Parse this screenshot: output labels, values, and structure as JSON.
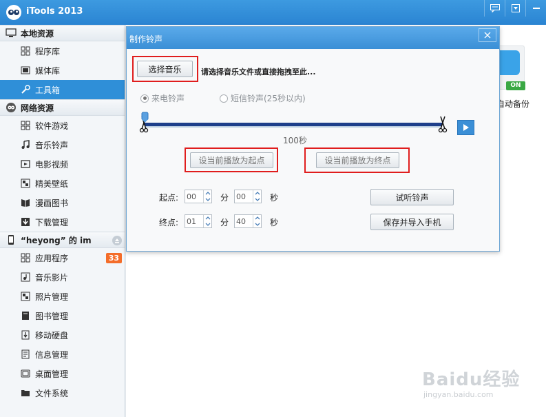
{
  "app": {
    "title": "iTools 2013"
  },
  "window_buttons": [
    {
      "icon": "chat-icon"
    },
    {
      "icon": "dropdown-menu-icon"
    },
    {
      "icon": "minimize-icon"
    }
  ],
  "sidebar": {
    "sections": [
      {
        "title": "本地资源",
        "icon": "computer-icon",
        "items": [
          {
            "label": "程序库",
            "icon": "grid-icon"
          },
          {
            "label": "媒体库",
            "icon": "media-icon"
          },
          {
            "label": "工具箱",
            "icon": "wrench-icon",
            "active": true
          }
        ]
      },
      {
        "title": "网络资源",
        "icon": "globe-icon",
        "items": [
          {
            "label": "软件游戏",
            "icon": "grid-icon"
          },
          {
            "label": "音乐铃声",
            "icon": "music-note-icon"
          },
          {
            "label": "电影视频",
            "icon": "film-icon"
          },
          {
            "label": "精美壁纸",
            "icon": "picture-icon"
          },
          {
            "label": "漫画图书",
            "icon": "book-icon"
          },
          {
            "label": "下载管理",
            "icon": "download-icon"
          }
        ]
      },
      {
        "title": "“heyong” 的 im",
        "icon": "phone-icon",
        "items": [
          {
            "label": "应用程序",
            "icon": "grid-icon",
            "badge": "33"
          },
          {
            "label": "音乐影片",
            "icon": "music-note-icon"
          },
          {
            "label": "照片管理",
            "icon": "picture-icon"
          },
          {
            "label": "图书管理",
            "icon": "book-icon"
          },
          {
            "label": "移动硬盘",
            "icon": "usb-icon"
          },
          {
            "label": "信息管理",
            "icon": "message-icon"
          },
          {
            "label": "桌面管理",
            "icon": "desktop-icon"
          },
          {
            "label": "文件系统",
            "icon": "folder-icon"
          }
        ]
      }
    ]
  },
  "background": {
    "card_label": "自动备份",
    "on_badge": "ON"
  },
  "dialog": {
    "title": "制作铃声",
    "select_music_button": "选择音乐",
    "hint": "请选择音乐文件或直接拖拽至此...",
    "radio_call": "来电铃声",
    "radio_sms": "短信铃声(25秒以内)",
    "duration": "100秒",
    "set_start_button": "设当前播放为起点",
    "set_end_button": "设当前播放为终点",
    "start_label": "起点:",
    "end_label": "终点:",
    "min_unit": "分",
    "sec_unit": "秒",
    "start_min": "00",
    "start_sec": "00",
    "end_min": "01",
    "end_sec": "40",
    "preview_button": "试听铃声",
    "save_button": "保存并导入手机",
    "progress": 0
  },
  "watermark": {
    "text": "Baidu经验",
    "sub": "jingyan.baidu.com"
  }
}
